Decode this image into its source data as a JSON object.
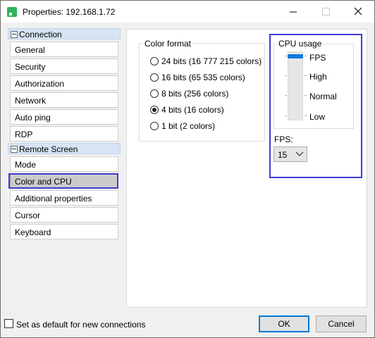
{
  "window": {
    "title": "Properties: 192.168.1.72"
  },
  "sidebar": {
    "groups": [
      {
        "label": "Connection",
        "items": [
          "General",
          "Security",
          "Authorization",
          "Network",
          "Auto ping",
          "RDP"
        ]
      },
      {
        "label": "Remote Screen",
        "items": [
          "Mode",
          "Color and CPU",
          "Additional properties",
          "Cursor",
          "Keyboard"
        ]
      }
    ],
    "selected": "Color and CPU"
  },
  "color_format": {
    "title": "Color format",
    "options": [
      "24 bits (16 777 215 colors)",
      "16 bits (65 535 colors)",
      "8 bits (256 colors)",
      "4 bits (16 colors)",
      "1 bit (2 colors)"
    ],
    "selected": "4 bits (16 colors)"
  },
  "cpu_usage": {
    "title": "CPU usage",
    "levels": [
      "FPS",
      "High",
      "Normal",
      "Low"
    ],
    "current_level": "FPS",
    "fps_label": "FPS:",
    "fps_value": "15"
  },
  "footer": {
    "default_checkbox_label": "Set as default for new connections",
    "default_checked": false,
    "ok_label": "OK",
    "cancel_label": "Cancel"
  },
  "colors": {
    "accent": "#0078d7",
    "highlight_outline": "#3d3dd4",
    "group_header": "#d6e4f4",
    "app_icon": "#2fb35a"
  }
}
